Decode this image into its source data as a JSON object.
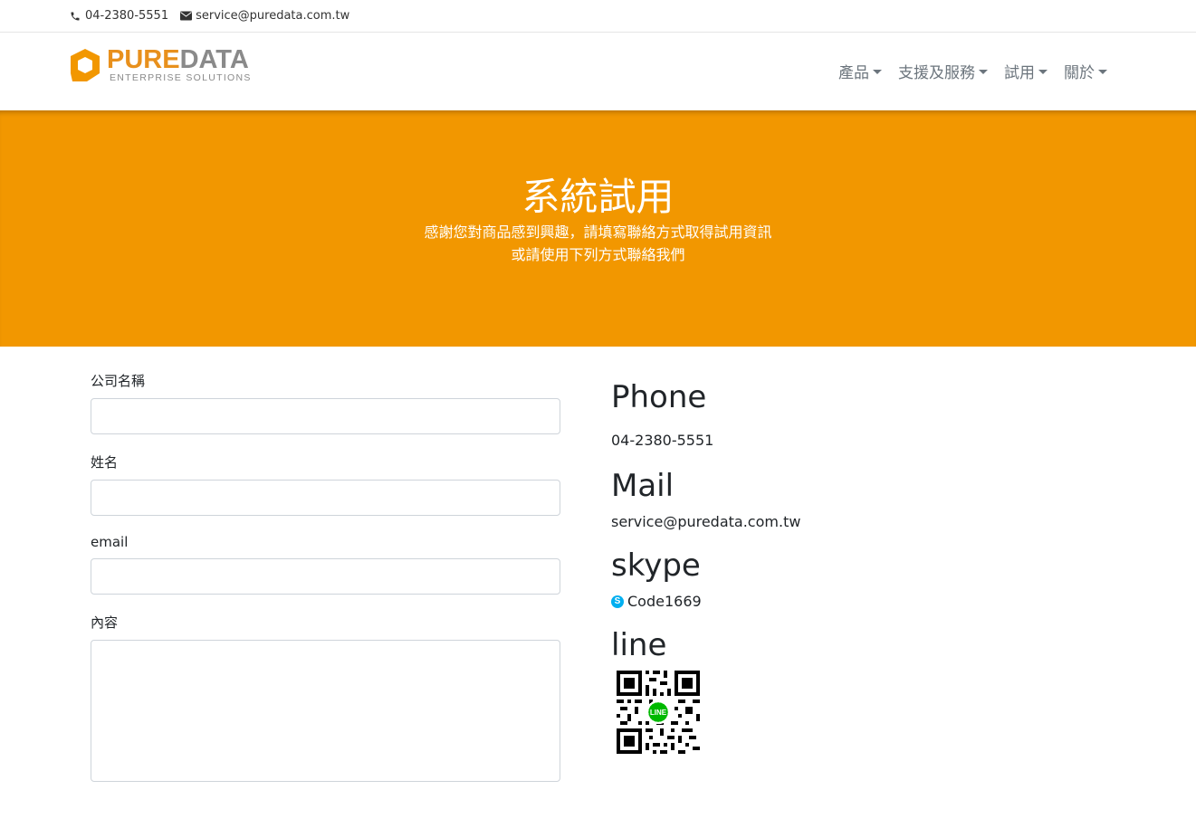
{
  "topbar": {
    "phone": "04-2380-5551",
    "email": "service@puredata.com.tw",
    "phone_icon": "phone-icon",
    "email_icon": "envelope-icon"
  },
  "logo": {
    "brand_part1": "PURE",
    "brand_part2": "DATA",
    "tagline": "ENTERPRISE SOLUTIONS"
  },
  "nav": {
    "items": [
      {
        "label": "產品"
      },
      {
        "label": "支援及服務"
      },
      {
        "label": "試用"
      },
      {
        "label": "關於"
      }
    ]
  },
  "hero": {
    "title": "系統試用",
    "line1": "感謝您對商品感到興趣，請填寫聯絡方式取得試用資訊",
    "line2": "或請使用下列方式聯絡我們"
  },
  "form": {
    "company_label": "公司名稱",
    "name_label": "姓名",
    "email_label": "email",
    "content_label": "內容"
  },
  "contact": {
    "phone_heading": "Phone",
    "phone_value": "04-2380-5551",
    "mail_heading": "Mail",
    "mail_value": "service@puredata.com.tw",
    "skype_heading": "skype",
    "skype_value": "Code1669",
    "line_heading": "line",
    "line_badge": "LINE"
  },
  "colors": {
    "hero_bg": "#f29700",
    "brand_orange": "#e8901c",
    "brand_gray": "#8a8a8a",
    "skype_blue": "#00aff0",
    "line_green": "#00b900"
  }
}
